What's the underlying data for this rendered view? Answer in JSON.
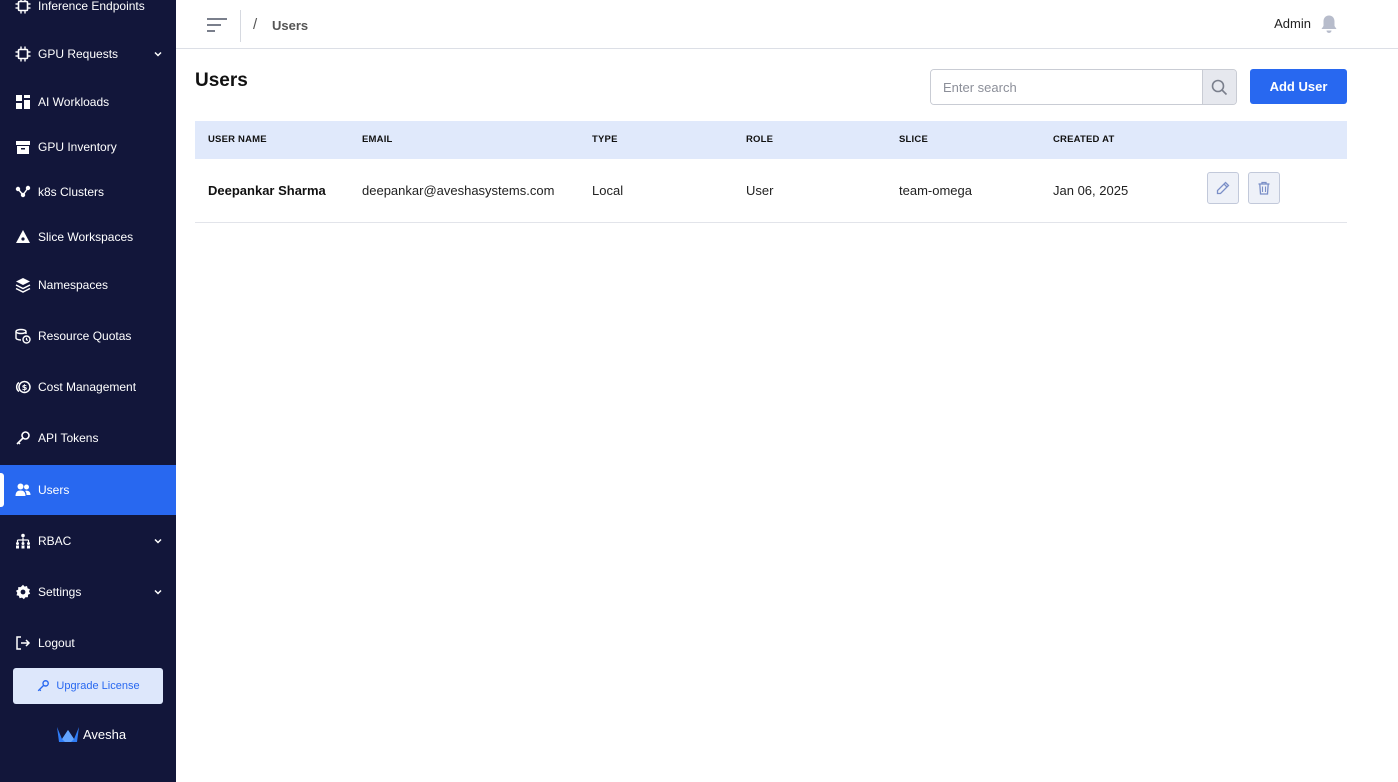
{
  "sidebar": {
    "items": [
      {
        "label": "Inference Endpoints",
        "icon": "chip-icon"
      },
      {
        "label": "GPU Requests",
        "icon": "chip-icon",
        "expandable": true
      },
      {
        "label": "AI Workloads",
        "icon": "grid-icon"
      },
      {
        "label": "GPU Inventory",
        "icon": "inventory-icon"
      },
      {
        "label": "k8s Clusters",
        "icon": "cluster-icon"
      },
      {
        "label": "Slice Workspaces",
        "icon": "slice-icon"
      },
      {
        "label": "Namespaces",
        "icon": "layers-icon"
      },
      {
        "label": "Resource Quotas",
        "icon": "quota-icon"
      },
      {
        "label": "Cost Management",
        "icon": "cost-icon"
      },
      {
        "label": "API Tokens",
        "icon": "key-icon"
      },
      {
        "label": "Users",
        "icon": "users-icon",
        "active": true
      },
      {
        "label": "RBAC",
        "icon": "rbac-icon",
        "expandable": true
      },
      {
        "label": "Settings",
        "icon": "gear-icon",
        "expandable": true
      },
      {
        "label": "Logout",
        "icon": "logout-icon"
      }
    ],
    "upgrade_label": "Upgrade License",
    "brand_name": "Avesha"
  },
  "header": {
    "breadcrumb_separator": "/",
    "breadcrumb_current": "Users",
    "user_name": "Admin"
  },
  "main": {
    "title": "Users",
    "search_placeholder": "Enter search",
    "add_button_label": "Add User",
    "table": {
      "columns": [
        "USER NAME",
        "EMAIL",
        "TYPE",
        "ROLE",
        "SLICE",
        "CREATED AT"
      ],
      "rows": [
        {
          "user_name": "Deepankar Sharma",
          "email": "deepankar@aveshasystems.com",
          "type": "Local",
          "role": "User",
          "slice": "team-omega",
          "created_at": "Jan 06, 2025"
        }
      ]
    }
  },
  "colors": {
    "sidebar_bg": "#12163a",
    "accent": "#2868f0",
    "table_header_bg": "#e0e9fb"
  }
}
